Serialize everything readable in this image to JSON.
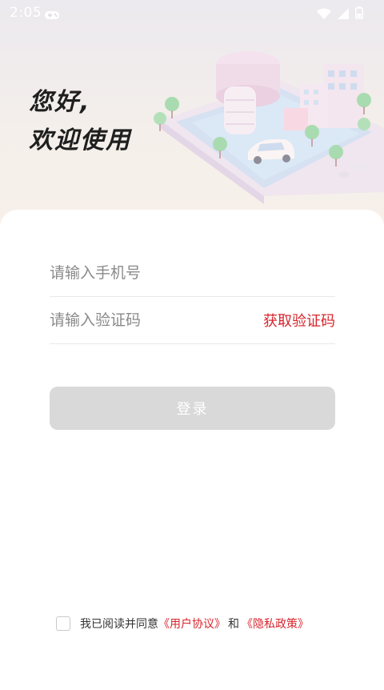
{
  "status_bar": {
    "time": "2:05"
  },
  "header": {
    "greeting_line1": "您好,",
    "greeting_line2": "欢迎使用"
  },
  "form": {
    "phone_placeholder": "请输入手机号",
    "code_placeholder": "请输入验证码",
    "get_code_label": "获取验证码",
    "login_label": "登录"
  },
  "agreement": {
    "prefix": "我已阅读并同意",
    "user_agreement": "《用户协议》",
    "and": "和",
    "privacy_policy": "《隐私政策》",
    "checked": false
  },
  "colors": {
    "accent": "#d8242c",
    "button_disabled": "#d9d9d9"
  }
}
